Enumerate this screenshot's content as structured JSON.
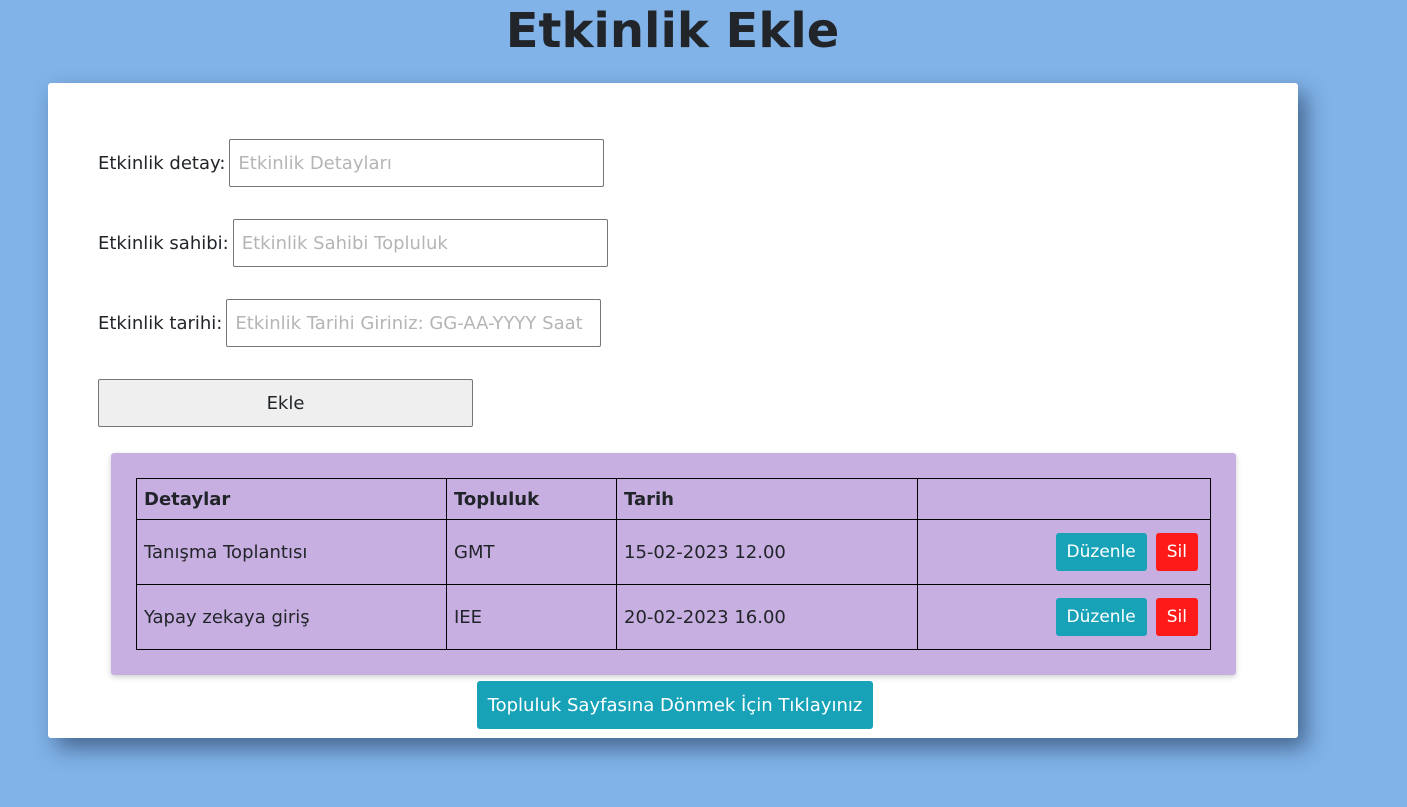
{
  "page": {
    "title": "Etkinlik Ekle"
  },
  "form": {
    "detail_label": "Etkinlik detay:",
    "detail_placeholder": "Etkinlik Detayları",
    "detail_value": "",
    "owner_label": "Etkinlik sahibi:",
    "owner_placeholder": "Etkinlik Sahibi Topluluk",
    "owner_value": "",
    "date_label": "Etkinlik tarihi:",
    "date_placeholder": "Etkinlik Tarihi Giriniz: GG-AA-YYYY Saat",
    "date_value": "",
    "add_button_label": "Ekle"
  },
  "table": {
    "headers": [
      "Detaylar",
      "Topluluk",
      "Tarih",
      ""
    ],
    "rows": [
      {
        "detail": "Tanışma Toplantısı",
        "group": "GMT",
        "date": "15-02-2023 12.00",
        "edit_label": "Düzenle",
        "delete_label": "Sil"
      },
      {
        "detail": "Yapay zekaya giriş",
        "group": "IEE",
        "date": "20-02-2023 16.00",
        "edit_label": "Düzenle",
        "delete_label": "Sil"
      }
    ]
  },
  "footer": {
    "back_button_label": "Topluluk Sayfasına Dönmek İçin Tıklayınız"
  },
  "colors": {
    "background": "#81b2e8",
    "card": "#ffffff",
    "table_panel": "#c8afe2",
    "edit_button": "#17a2b8",
    "delete_button": "#ff1a1a",
    "back_button": "#17a2b8"
  }
}
